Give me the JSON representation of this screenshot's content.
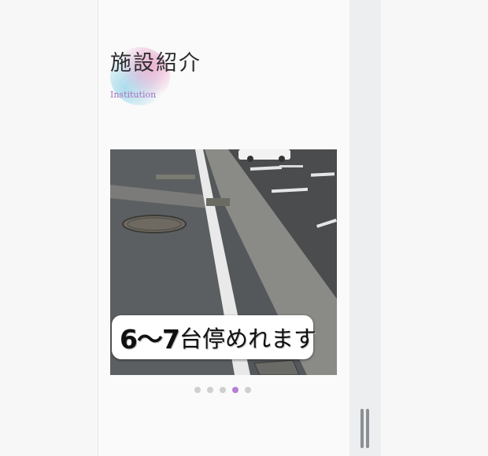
{
  "section": {
    "title": "施設紹介",
    "subtitle": "Institution"
  },
  "slider": {
    "caption_number": "6〜7",
    "caption_text": "台停めれます",
    "active_index": 3,
    "dot_count": 5
  },
  "colors": {
    "accent": "#b57fd6",
    "subtitle": "#a86fc0",
    "dot_inactive": "#cfcfcf"
  }
}
